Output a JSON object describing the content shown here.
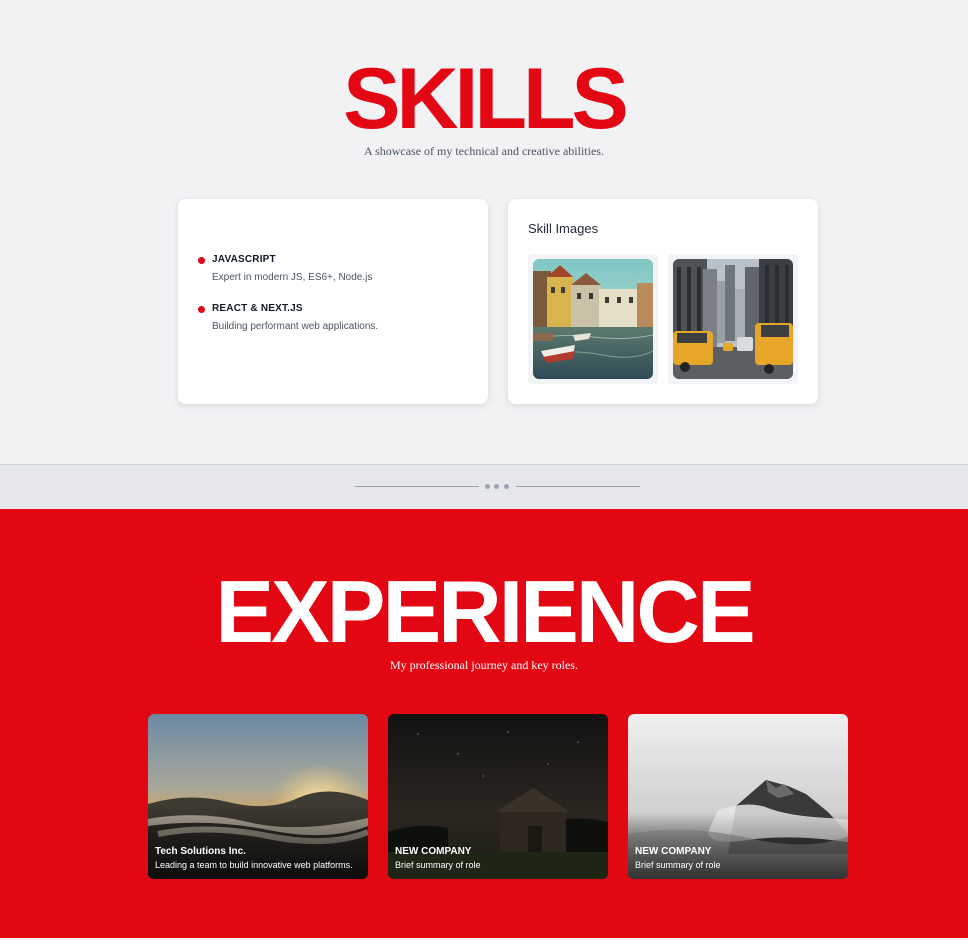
{
  "skills": {
    "title": "SKILLS",
    "subtitle": "A showcase of my technical and creative abilities.",
    "items": [
      {
        "name": "JAVASCRIPT",
        "description": "Expert in modern JS, ES6+, Node.js"
      },
      {
        "name": "REACT & NEXT.JS",
        "description": "Building performant web applications."
      }
    ],
    "images_title": "Skill Images",
    "images": [
      {
        "icon": "canal-town-photo"
      },
      {
        "icon": "city-street-taxis-photo"
      }
    ]
  },
  "experience": {
    "title": "EXPERIENCE",
    "subtitle": "My professional journey and key roles.",
    "cards": [
      {
        "company": "Tech Solutions Inc.",
        "role": "Leading a team to build innovative web platforms.",
        "icon": "sunrise-hills-photo"
      },
      {
        "company": "NEW COMPANY",
        "role": "Brief summary of role",
        "icon": "night-barn-photo"
      },
      {
        "company": "NEW COMPANY",
        "role": "Brief summary of role",
        "icon": "misty-mountain-photo"
      }
    ]
  },
  "colors": {
    "accent": "#e30613",
    "page_bg": "#f2f2f5",
    "divider_bg": "#e5e7eb"
  }
}
